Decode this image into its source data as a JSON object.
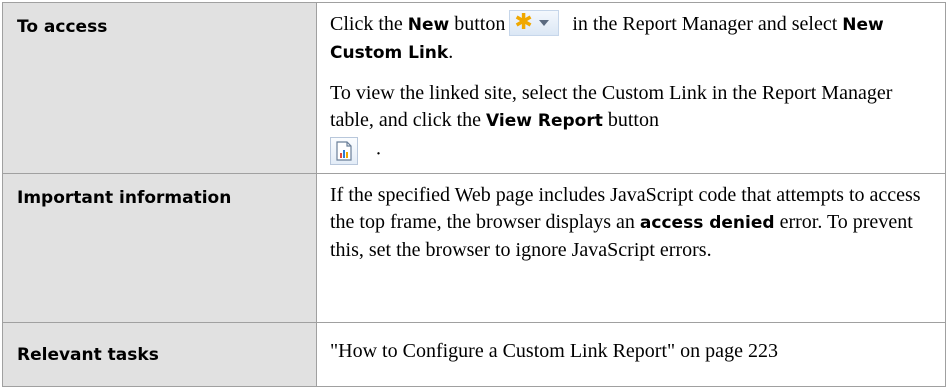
{
  "rows": [
    {
      "label": "To access",
      "p1": {
        "t1": "Click the ",
        "b1": "New",
        "t2": " button",
        "t3": " in the Report Manager and select ",
        "b2": "New Custom Link",
        "t4": "."
      },
      "p2": {
        "t1": "To view the linked site, select the Custom Link in the Report Manager table, and click the ",
        "b1": "View Report",
        "t2": " button",
        "t3": "."
      }
    },
    {
      "label": "Important information",
      "c": {
        "t1": "If the specified Web page includes JavaScript code that attempts to access the top frame, the browser displays an ",
        "b1": "access denied",
        "t2": " error. To prevent this, set the browser to ignore JavaScript errors."
      }
    },
    {
      "label": "Relevant tasks",
      "link": "\"How to Configure a Custom Link Report\" on page 223"
    }
  ],
  "icons": {
    "new_button": "new-star-dropdown-icon",
    "view_report": "view-report-chart-icon",
    "star_color": "#f0a800"
  }
}
